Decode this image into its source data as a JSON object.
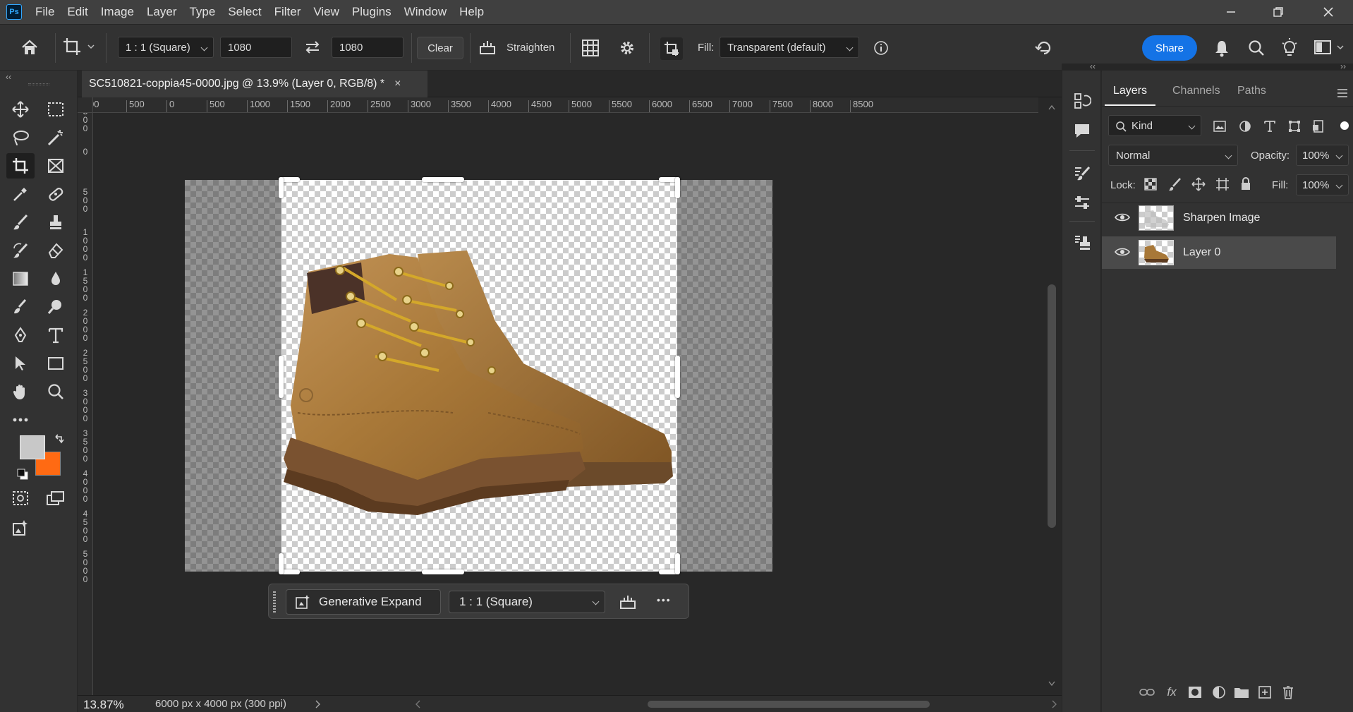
{
  "app": {
    "logo": "Ps"
  },
  "menu": [
    "File",
    "Edit",
    "Image",
    "Layer",
    "Type",
    "Select",
    "Filter",
    "View",
    "Plugins",
    "Window",
    "Help"
  ],
  "options_bar": {
    "ratio_preset": "1 : 1 (Square)",
    "width": "1080",
    "height": "1080",
    "clear_label": "Clear",
    "straighten_label": "Straighten",
    "fill_label": "Fill:",
    "fill_value": "Transparent (default)",
    "share_label": "Share"
  },
  "document": {
    "tab_title": "SC510821-coppia45-0000.jpg @ 13.9% (Layer 0, RGB/8) *",
    "close_glyph": "×"
  },
  "ruler": {
    "top_labels": [
      "00",
      "500",
      "0",
      "500",
      "1000",
      "1500",
      "2000",
      "2500",
      "3000",
      "3500",
      "4000",
      "4500",
      "5000",
      "5500",
      "6000",
      "6500",
      "7000",
      "7500",
      "8000",
      "8500"
    ],
    "left_labels": [
      "500",
      "0",
      "500",
      "1000",
      "1500",
      "2000",
      "2500",
      "3000",
      "3500",
      "4000",
      "4500",
      "5000"
    ]
  },
  "context_bar": {
    "generative_expand_label": "Generative Expand",
    "ratio_value": "1 : 1 (Square)",
    "more_glyph": "•••"
  },
  "status": {
    "zoom": "13.87%",
    "doc_size": "6000 px x 4000 px (300 ppi)"
  },
  "layers_panel": {
    "tabs": [
      "Layers",
      "Channels",
      "Paths"
    ],
    "kind_filter": "Kind",
    "blend_mode": "Normal",
    "opacity_label": "Opacity:",
    "opacity_value": "100%",
    "lock_label": "Lock:",
    "fill_label": "Fill:",
    "fill_value": "100%",
    "layers": [
      {
        "name": "Sharpen Image",
        "visible": true,
        "selected": false
      },
      {
        "name": "Layer 0",
        "visible": true,
        "selected": true
      }
    ]
  },
  "colors": {
    "foreground": "#c8c8c8",
    "background": "#ff6a13",
    "accent": "#1473e6"
  },
  "icons": [
    "home-icon",
    "crop-icon",
    "swap-icon",
    "straighten-icon",
    "grid-overlay-icon",
    "gear-icon",
    "content-aware-icon",
    "info-icon",
    "reset-icon",
    "bell-icon",
    "search-icon",
    "lightbulb-icon",
    "workspace-icon"
  ]
}
